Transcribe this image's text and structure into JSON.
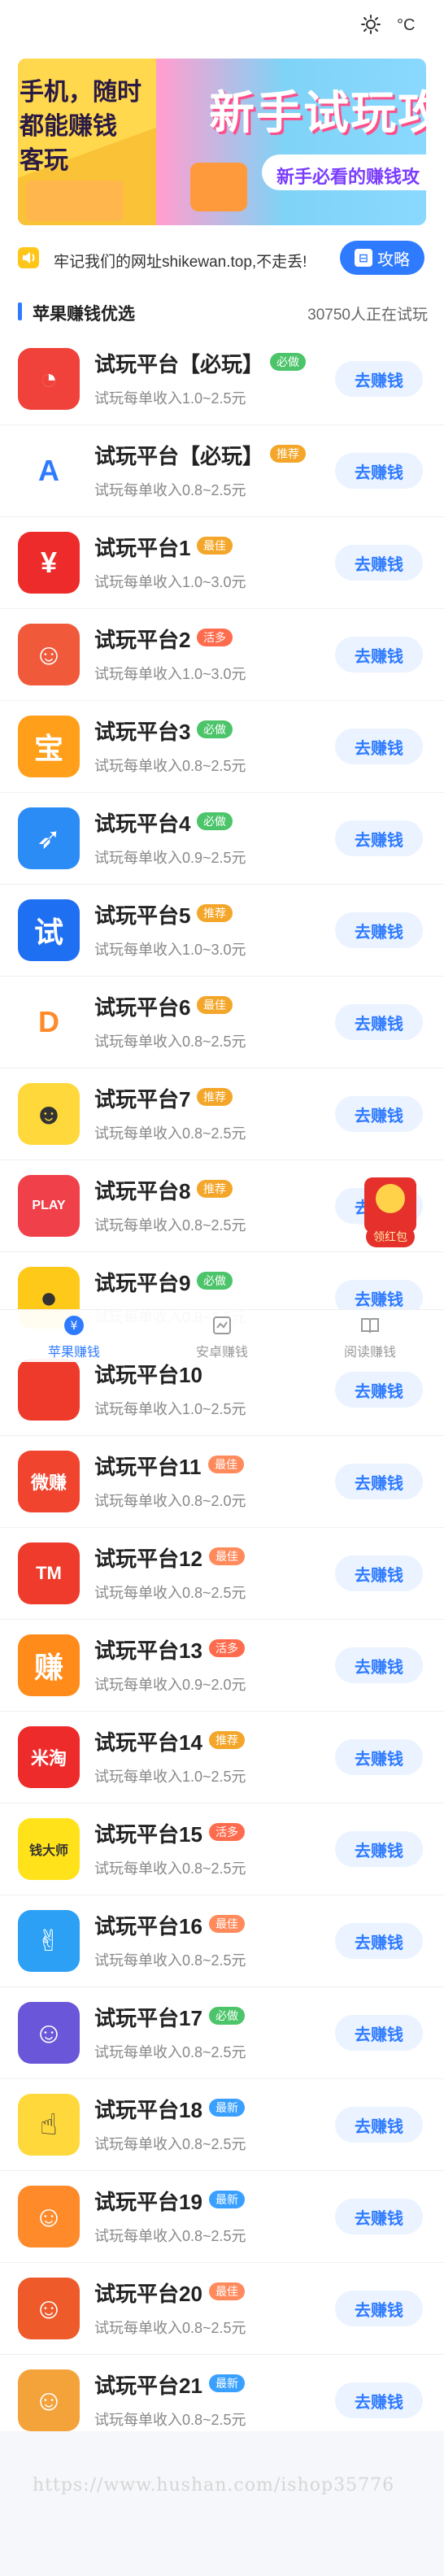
{
  "status": {
    "temperature_unit": "°C",
    "weather_icon": "sun-icon"
  },
  "banner": {
    "left_lines": [
      "手机，随时",
      "都能赚钱",
      "客玩"
    ],
    "title": "新手试玩攻",
    "subtitle": "新手必看的赚钱攻"
  },
  "notice": {
    "text": "牢记我们的网址shikewan.top,不走丢!",
    "guide_label": "攻略"
  },
  "section": {
    "title": "苹果赚钱优选",
    "online_count": "30750人正在试玩"
  },
  "go_label": "去赚钱",
  "colors": {
    "accent": "#2f7bff",
    "badge_green": "#4cc46a",
    "badge_orange": "#f4a62a",
    "badge_red": "#ff6b4d",
    "badge_blue": "#3aa0ff"
  },
  "apps": [
    {
      "name": "试玩平台【必玩】",
      "badge": "必做",
      "badge_color": "#4cc46a",
      "desc": "试玩每单收入1.0~2.5元",
      "icon": "pacman-icon",
      "icon_bg": "#f0423a",
      "icon_text": "◔"
    },
    {
      "name": "试玩平台【必玩】",
      "badge": "推荐",
      "badge_color": "#f4a62a",
      "desc": "试玩每单收入0.8~2.5元",
      "icon": "rocket-a-icon",
      "icon_bg": "#ffffff",
      "icon_text": "A"
    },
    {
      "name": "试玩平台1",
      "badge": "最佳",
      "badge_color": "#f4a62a",
      "desc": "试玩每单收入1.0~3.0元",
      "icon": "yuan-icon",
      "icon_bg": "#ee2b2b",
      "icon_text": "¥"
    },
    {
      "name": "试玩平台2",
      "badge": "活多",
      "badge_color": "#ff6b4d",
      "desc": "试玩每单收入1.0~3.0元",
      "icon": "face-hat-icon",
      "icon_bg": "#f05a3a",
      "icon_text": "☺"
    },
    {
      "name": "试玩平台3",
      "badge": "必做",
      "badge_color": "#4cc46a",
      "desc": "试玩每单收入0.8~2.5元",
      "icon": "treasure-icon",
      "icon_bg": "#ff9f1a",
      "icon_text": "宝"
    },
    {
      "name": "试玩平台4",
      "badge": "必做",
      "badge_color": "#4cc46a",
      "desc": "试玩每单收入0.9~2.5元",
      "icon": "rocket-icon",
      "icon_bg": "#2b8cf5",
      "icon_text": "➶"
    },
    {
      "name": "试玩平台5",
      "badge": "推荐",
      "badge_color": "#f4a62a",
      "desc": "试玩每单收入1.0~3.0元",
      "icon": "shi-icon",
      "icon_bg": "#1f6ff2",
      "icon_text": "试"
    },
    {
      "name": "试玩平台6",
      "badge": "最佳",
      "badge_color": "#f4a62a",
      "desc": "试玩每单收入0.8~2.5元",
      "icon": "play-d-icon",
      "icon_bg": "#ffffff",
      "icon_text": "D"
    },
    {
      "name": "试玩平台7",
      "badge": "推荐",
      "badge_color": "#f4a62a",
      "desc": "试玩每单收入0.8~2.5元",
      "icon": "avatar-icon",
      "icon_bg": "#ffd93b",
      "icon_text": "☻"
    },
    {
      "name": "试玩平台8",
      "badge": "推荐",
      "badge_color": "#f4a62a",
      "desc": "试玩每单收入0.8~2.5元",
      "icon": "play-icon",
      "icon_bg": "#f0404a",
      "icon_text": "PLAY"
    },
    {
      "name": "试玩平台9",
      "badge": "必做",
      "badge_color": "#4cc46a",
      "desc": "试玩每单收入0.8~2.5元",
      "icon": "bee-icon",
      "icon_bg": "#ffc91a",
      "icon_text": "●"
    },
    {
      "name": "试玩平台10",
      "badge": "",
      "badge_color": "#4cc46a",
      "desc": "试玩每单收入1.0~2.5元",
      "icon": "red-app-icon",
      "icon_bg": "#ee3a2a",
      "icon_text": ""
    },
    {
      "name": "试玩平台11",
      "badge": "最佳",
      "badge_color": "#ff8a5c",
      "desc": "试玩每单收入0.8~2.0元",
      "icon": "weizhuan-icon",
      "icon_bg": "#f0442e",
      "icon_text": "微赚"
    },
    {
      "name": "试玩平台12",
      "badge": "最佳",
      "badge_color": "#ff8a5c",
      "desc": "试玩每单收入0.8~2.5元",
      "icon": "tm-icon",
      "icon_bg": "#ee3b2b",
      "icon_text": "TM"
    },
    {
      "name": "试玩平台13",
      "badge": "活多",
      "badge_color": "#ff6b4d",
      "desc": "试玩每单收入0.9~2.0元",
      "icon": "zhuan-icon",
      "icon_bg": "#ff8c1a",
      "icon_text": "赚"
    },
    {
      "name": "试玩平台14",
      "badge": "推荐",
      "badge_color": "#f4a62a",
      "desc": "试玩每单收入1.0~2.5元",
      "icon": "mitao-icon",
      "icon_bg": "#ee2b2b",
      "icon_text": "米淘"
    },
    {
      "name": "试玩平台15",
      "badge": "活多",
      "badge_color": "#ff6b4d",
      "desc": "试玩每单收入0.8~2.5元",
      "icon": "qiandashi-icon",
      "icon_bg": "#ffe21a",
      "icon_text": "钱大师"
    },
    {
      "name": "试玩平台16",
      "badge": "最佳",
      "badge_color": "#ff8a5c",
      "desc": "试玩每单收入0.8~2.5元",
      "icon": "hand-icon",
      "icon_bg": "#2ba0f5",
      "icon_text": "✌"
    },
    {
      "name": "试玩平台17",
      "badge": "必做",
      "badge_color": "#4cc46a",
      "desc": "试玩每单收入0.8~2.5元",
      "icon": "detective-icon",
      "icon_bg": "#6a56d8",
      "icon_text": "☺"
    },
    {
      "name": "试玩平台18",
      "badge": "最新",
      "badge_color": "#3aa0ff",
      "desc": "试玩每单收入0.8~2.5元",
      "icon": "finger-icon",
      "icon_bg": "#ffd93b",
      "icon_text": "☝"
    },
    {
      "name": "试玩平台19",
      "badge": "最新",
      "badge_color": "#3aa0ff",
      "desc": "试玩每单收入0.8~2.5元",
      "icon": "crayon-icon",
      "icon_bg": "#ff8a2a",
      "icon_text": "☺"
    },
    {
      "name": "试玩平台20",
      "badge": "最佳",
      "badge_color": "#ff8a5c",
      "desc": "试玩每单收入0.8~2.5元",
      "icon": "lion-icon",
      "icon_bg": "#ee5a2a",
      "icon_text": "☺"
    },
    {
      "name": "试玩平台21",
      "badge": "最新",
      "badge_color": "#3aa0ff",
      "desc": "试玩每单收入0.8~2.5元",
      "icon": "squirrel-icon",
      "icon_bg": "#f4a23a",
      "icon_text": "☺"
    }
  ],
  "redpacket": {
    "label": "领红包"
  },
  "tabs": [
    {
      "label": "苹果赚钱",
      "icon": "apple-money-icon",
      "active": true
    },
    {
      "label": "安卓赚钱",
      "icon": "android-money-icon",
      "active": false
    },
    {
      "label": "阅读赚钱",
      "icon": "book-icon",
      "active": false
    }
  ],
  "footer": {
    "watermark": "https://www.hushan.com/ishop35776"
  }
}
